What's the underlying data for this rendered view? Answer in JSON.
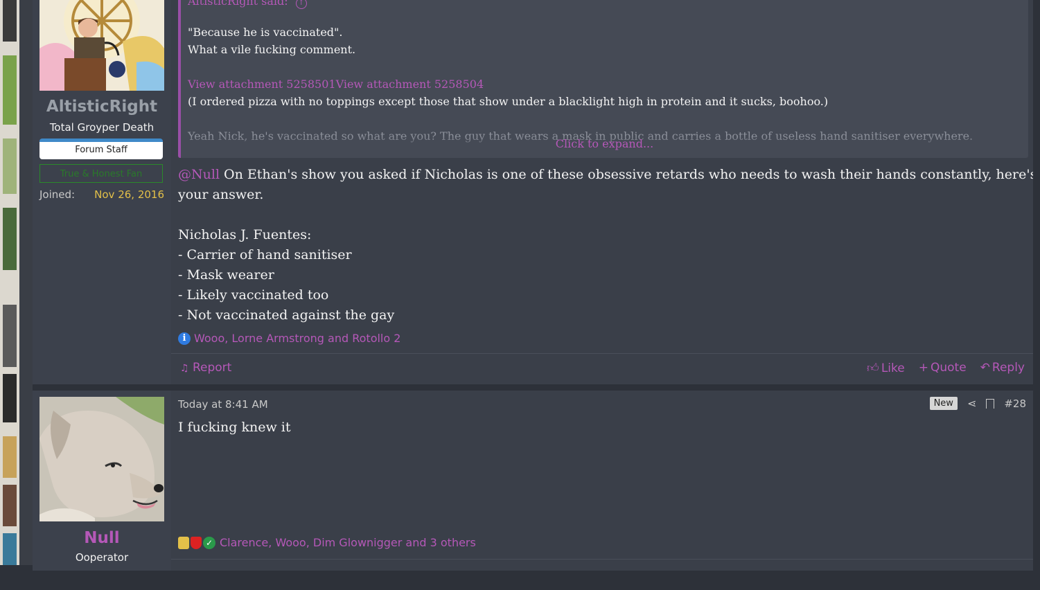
{
  "post1": {
    "user": {
      "name": "AltisticRight",
      "title": "Total Groyper Death",
      "staff_badge": "Forum Staff",
      "banner": "True & Honest Fan",
      "joined_label": "Joined:",
      "joined_value": "Nov 26, 2016",
      "name_color": "#9aa0a8"
    },
    "quote": {
      "author_line": "AltisticRight said:",
      "lines": [
        "\"Because he is vaccinated\".",
        "What a vile fucking comment.",
        "",
        "View attachment 5258501View attachment 5258504",
        "(I ordered pizza with no toppings except those that show under a blacklight high in protein and it sucks, boohoo.)",
        "",
        "Yeah Nick, he's vaccinated so what are you? The guy that wears a mask in public and carries a bottle of useless hand sanitiser everywhere."
      ],
      "expand": "Click to expand..."
    },
    "body": {
      "mention": "@Null",
      "line1_rest": " On Ethan's show you asked if Nicholas is one of these obsessive retards who needs to wash their hands constantly, here's",
      "line2": "your answer.",
      "list_title": "Nicholas J. Fuentes:",
      "items": [
        "- Carrier of hand sanitiser",
        "- Mask wearer",
        "- Likely vaccinated too",
        "- Not vaccinated against the gay"
      ]
    },
    "reactions": "Wooo, Lorne Armstrong and Rotollo 2",
    "footer": {
      "report": "Report",
      "like": "Like",
      "quote": "Quote",
      "reply": "Reply"
    }
  },
  "post2": {
    "user": {
      "name": "Null",
      "title": "Ooperator",
      "name_color": "#b558b8"
    },
    "timestamp": "Today at 8:41 AM",
    "new_badge": "New",
    "post_number": "#28",
    "body": "I fucking knew it",
    "reactions": "Clarence, Wooo, Dim Glownigger and 3 others"
  },
  "colors": {
    "accent": "#b558b8",
    "joined_date": "#e3c049",
    "panel": "#3c414c",
    "quote_bg": "#454a55"
  }
}
